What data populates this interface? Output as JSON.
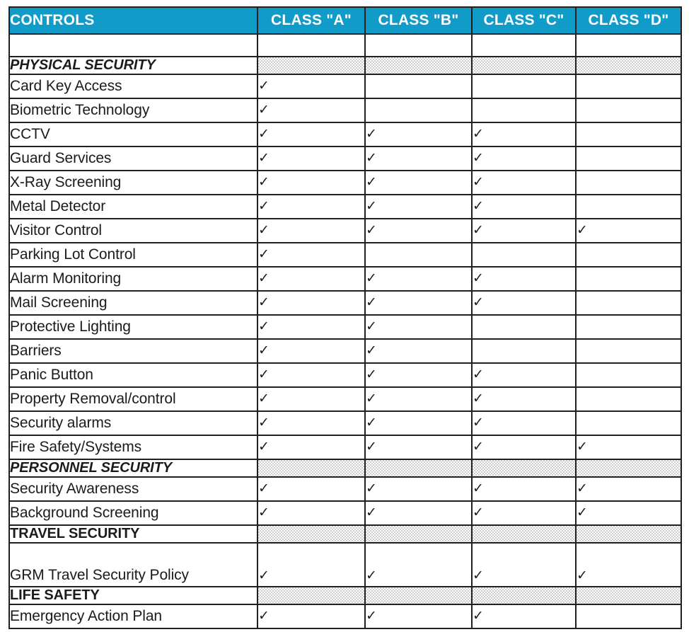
{
  "table": {
    "columns": [
      {
        "key": "controls",
        "label": "CONTROLS"
      },
      {
        "key": "a",
        "label": "CLASS \"A\""
      },
      {
        "key": "b",
        "label": "CLASS \"B\""
      },
      {
        "key": "c",
        "label": "CLASS \"C\""
      },
      {
        "key": "d",
        "label": "CLASS \"D\""
      }
    ],
    "header_bg": "#109BC8",
    "header_text_color": "#FFFFFF",
    "border_color": "#231F20",
    "section_fill_color": "#CDCDCD",
    "check_glyph": "✓",
    "rows": [
      {
        "type": "blank",
        "label": "",
        "a": false,
        "b": false,
        "c": false,
        "d": false
      },
      {
        "type": "section",
        "italic": true,
        "label": "PHYSICAL SECURITY",
        "a": false,
        "b": false,
        "c": false,
        "d": false
      },
      {
        "type": "item",
        "label": "Card Key Access",
        "a": true,
        "b": false,
        "c": false,
        "d": false
      },
      {
        "type": "item",
        "label": "Biometric Technology",
        "a": true,
        "b": false,
        "c": false,
        "d": false
      },
      {
        "type": "item",
        "label": "CCTV",
        "a": true,
        "b": true,
        "c": true,
        "d": false
      },
      {
        "type": "item",
        "label": "Guard Services",
        "a": true,
        "b": true,
        "c": true,
        "d": false
      },
      {
        "type": "item",
        "label": "X-Ray Screening",
        "a": true,
        "b": true,
        "c": true,
        "d": false
      },
      {
        "type": "item",
        "label": "Metal Detector",
        "a": true,
        "b": true,
        "c": true,
        "d": false
      },
      {
        "type": "item",
        "label": "Visitor Control",
        "a": true,
        "b": true,
        "c": true,
        "d": true
      },
      {
        "type": "item",
        "label": "Parking Lot Control",
        "a": true,
        "b": false,
        "c": false,
        "d": false
      },
      {
        "type": "item",
        "label": "Alarm Monitoring",
        "a": true,
        "b": true,
        "c": true,
        "d": false
      },
      {
        "type": "item",
        "label": "Mail Screening",
        "a": true,
        "b": true,
        "c": true,
        "d": false
      },
      {
        "type": "item",
        "label": "Protective Lighting",
        "a": true,
        "b": true,
        "c": false,
        "d": false
      },
      {
        "type": "item",
        "label": "Barriers",
        "a": true,
        "b": true,
        "c": false,
        "d": false
      },
      {
        "type": "item",
        "label": "Panic Button",
        "a": true,
        "b": true,
        "c": true,
        "d": false
      },
      {
        "type": "item",
        "label": "Property Removal/control",
        "a": true,
        "b": true,
        "c": true,
        "d": false
      },
      {
        "type": "item",
        "label": "Security alarms",
        "a": true,
        "b": true,
        "c": true,
        "d": false
      },
      {
        "type": "item",
        "label": "Fire Safety/Systems",
        "a": true,
        "b": true,
        "c": true,
        "d": true
      },
      {
        "type": "section",
        "italic": true,
        "label": "PERSONNEL SECURITY",
        "a": false,
        "b": false,
        "c": false,
        "d": false
      },
      {
        "type": "item",
        "label": "Security Awareness",
        "a": true,
        "b": true,
        "c": true,
        "d": true
      },
      {
        "type": "item",
        "label": "Background Screening",
        "a": true,
        "b": true,
        "c": true,
        "d": true
      },
      {
        "type": "section",
        "italic": false,
        "label": "TRAVEL SECURITY",
        "a": false,
        "b": false,
        "c": false,
        "d": false
      },
      {
        "type": "tall",
        "label": "GRM Travel Security Policy",
        "a": true,
        "b": true,
        "c": true,
        "d": true
      },
      {
        "type": "section",
        "italic": false,
        "label": "LIFE SAFETY",
        "a": false,
        "b": false,
        "c": false,
        "d": false
      },
      {
        "type": "item",
        "label": "Emergency Action Plan",
        "a": true,
        "b": true,
        "c": true,
        "d": false
      }
    ]
  }
}
